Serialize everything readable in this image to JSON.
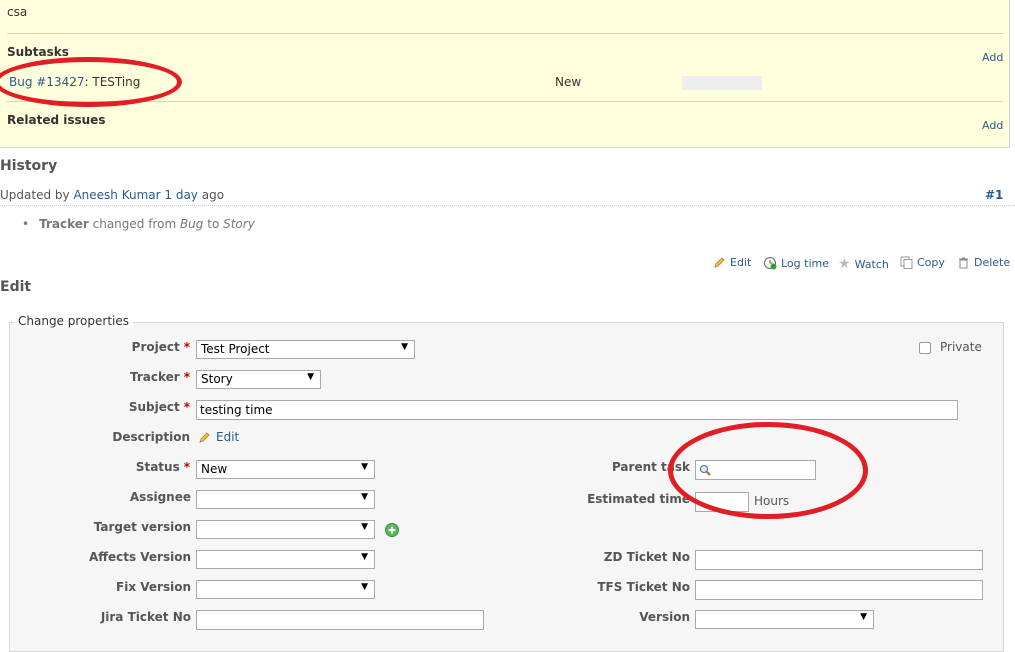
{
  "issue": {
    "description": "csa",
    "subtasks_label": "Subtasks",
    "add_label": "Add",
    "subtask": {
      "link": "Bug #13427",
      "title": ": TESTing",
      "status": "New",
      "done_ratio": 0
    },
    "related_label": "Related issues",
    "related_add_label": "Add"
  },
  "history": {
    "title": "History",
    "updated_by_prefix": "Updated by ",
    "author": "Aneesh Kumar",
    "when": "1 day",
    "ago": " ago",
    "journal_ref": "#1",
    "detail": {
      "field": "Tracker",
      "changed_from": " changed from ",
      "old": "Bug",
      "to": " to ",
      "new": "Story"
    }
  },
  "actions": {
    "edit": "Edit",
    "log_time": "Log time",
    "watch": "Watch",
    "copy": "Copy",
    "delete": "Delete"
  },
  "edit": {
    "title": "Edit",
    "legend": "Change properties",
    "private_label": "Private",
    "fields": {
      "project": {
        "label": "Project",
        "value": "Test Project"
      },
      "tracker": {
        "label": "Tracker",
        "value": "Story"
      },
      "subject": {
        "label": "Subject",
        "value": "testing time"
      },
      "description": {
        "label": "Description",
        "edit": "Edit"
      },
      "status": {
        "label": "Status",
        "value": "New"
      },
      "assignee": {
        "label": "Assignee",
        "value": ""
      },
      "target_version": {
        "label": "Target version",
        "value": ""
      },
      "affects_version": {
        "label": "Affects Version",
        "value": ""
      },
      "fix_version": {
        "label": "Fix Version",
        "value": ""
      },
      "jira_ticket": {
        "label": "Jira Ticket No",
        "value": ""
      },
      "parent_task": {
        "label": "Parent task",
        "value": ""
      },
      "estimated_time": {
        "label": "Estimated time",
        "value": "",
        "unit": "Hours"
      },
      "zd_ticket": {
        "label": "ZD Ticket No",
        "value": ""
      },
      "tfs_ticket": {
        "label": "TFS Ticket No",
        "value": ""
      },
      "version": {
        "label": "Version",
        "value": ""
      }
    }
  },
  "colors": {
    "annotation": "#e01e24",
    "link": "#2a5a8a",
    "issue_bg": "#ffffdd"
  }
}
